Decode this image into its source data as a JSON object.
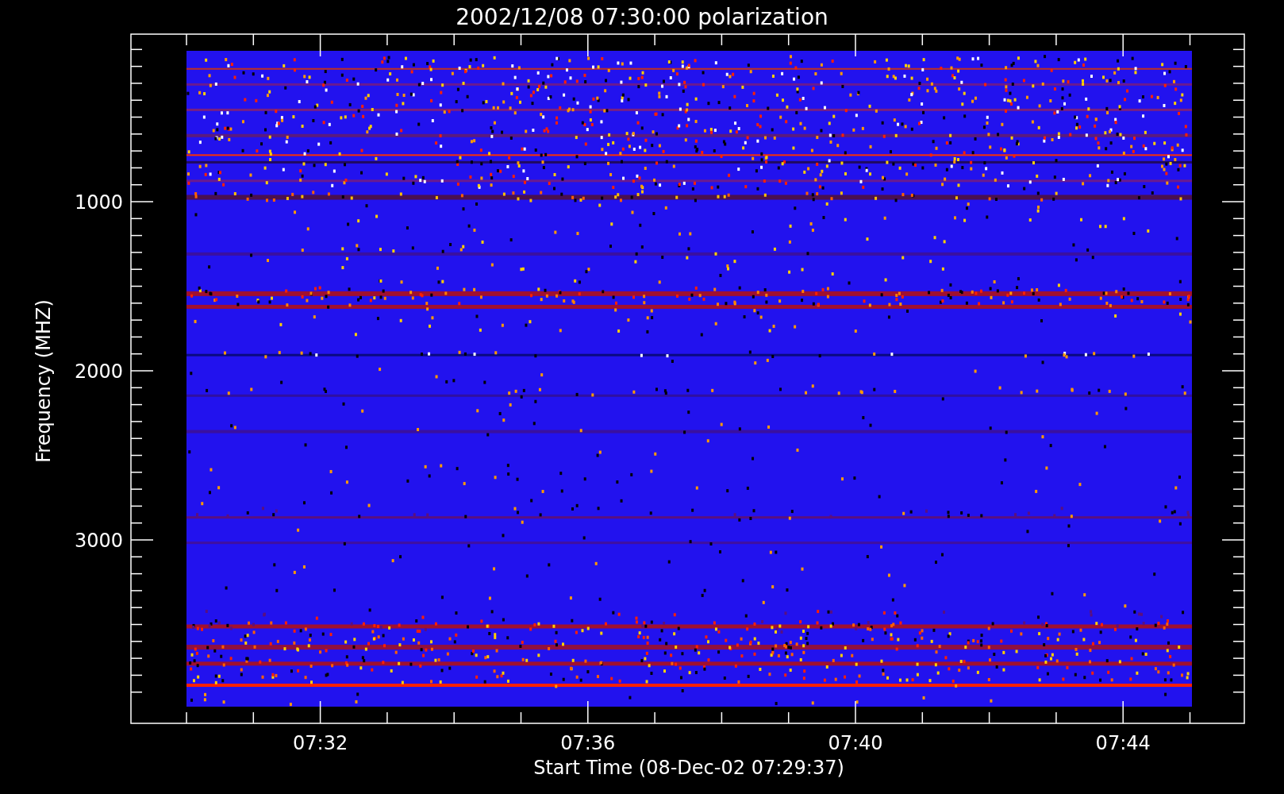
{
  "title": "2002/12/08 07:30:00 polarization",
  "y_axis": {
    "label": "Frequency (MHZ)",
    "ticks": [
      "1000",
      "2000",
      "3000"
    ]
  },
  "x_axis": {
    "label": "Start Time (08-Dec-02 07:29:37)",
    "ticks": [
      "07:32",
      "07:36",
      "07:40",
      "07:44"
    ]
  }
}
